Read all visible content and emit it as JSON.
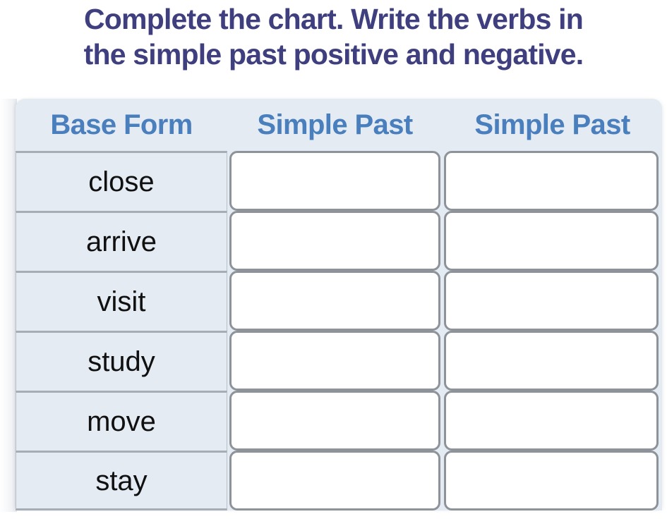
{
  "instruction": {
    "line1": "Complete the chart. Write the verbs in",
    "line2": "the simple past positive and negative."
  },
  "table": {
    "headers": [
      "Base Form",
      "Simple Past",
      "Simple Past"
    ],
    "rows": [
      {
        "base": "close",
        "simple_past_positive": "",
        "simple_past_negative": ""
      },
      {
        "base": "arrive",
        "simple_past_positive": "",
        "simple_past_negative": ""
      },
      {
        "base": "visit",
        "simple_past_positive": "",
        "simple_past_negative": ""
      },
      {
        "base": "study",
        "simple_past_positive": "",
        "simple_past_negative": ""
      },
      {
        "base": "move",
        "simple_past_positive": "",
        "simple_past_negative": ""
      },
      {
        "base": "stay",
        "simple_past_positive": "",
        "simple_past_negative": ""
      }
    ]
  },
  "colors": {
    "title": "#3f3f7f",
    "header_text": "#4a7fbd",
    "cell_background": "#e4ebf3",
    "cell_border": "#a7adb5",
    "answer_border": "#8d9399",
    "answer_background": "#ffffff",
    "page_background": "#ffffff"
  }
}
